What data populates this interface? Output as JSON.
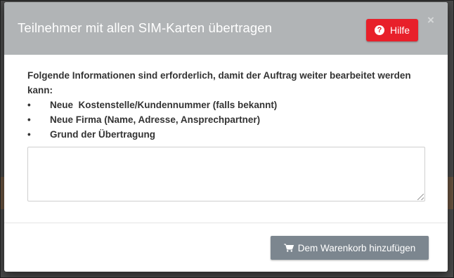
{
  "modal": {
    "title": "Teilnehmer mit allen SIM-Karten übertragen",
    "help_label": "Hilfe",
    "help_icon": "question-circle-icon",
    "close_icon": "close-icon",
    "close_glyph": "×"
  },
  "body": {
    "intro": "Folgende Informationen sind erforderlich, damit der Auftrag weiter bearbeitet werden kann:",
    "bullets": [
      "Neue  Kostenstelle/Kundennummer (falls bekannt)",
      "Neue Firma (Name, Adresse, Ansprechpartner)",
      "Grund der Übertragung"
    ],
    "bullet_glyph": "•",
    "textarea_value": ""
  },
  "footer": {
    "cart_button_label": "Dem Warenkorb hinzufügen",
    "cart_icon": "shopping-cart-icon"
  },
  "colors": {
    "header_bg": "#b1b4b6",
    "help_button": "#e8202a",
    "cart_button": "#7c868f"
  }
}
